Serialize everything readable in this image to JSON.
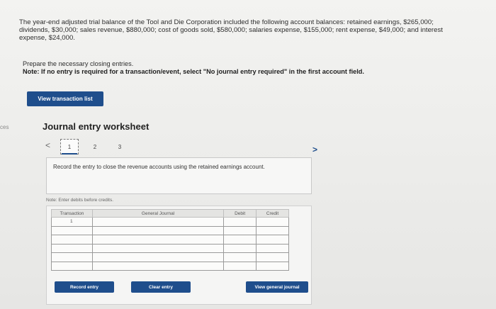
{
  "edge_label": "ces",
  "intro_text": "The year-end adjusted trial balance of the Tool and Die Corporation included the following account balances: retained earnings, $265,000; dividends, $30,000; sales revenue, $880,000; cost of goods sold, $580,000; salaries expense, $155,000; rent expense, $49,000; and interest expense, $24,000.",
  "instructions": {
    "line1": "Prepare the necessary closing entries.",
    "note": "Note: If no entry is required for a transaction/event, select \"No journal entry required\" in the first account field."
  },
  "view_transaction_list_label": "View transaction list",
  "worksheet": {
    "title": "Journal entry worksheet",
    "prev_glyph": "<",
    "next_glyph": ">",
    "steps": [
      "1",
      "2",
      "3"
    ],
    "active_step": 1,
    "task_text": "Record the entry to close the revenue accounts using the retained earnings account.",
    "note_text": "Note: Enter debits before credits.",
    "table": {
      "headers": [
        "Transaction",
        "General Journal",
        "Debit",
        "Credit"
      ],
      "rows": [
        {
          "transaction": "1",
          "account": "",
          "debit": "",
          "credit": ""
        },
        {
          "transaction": "",
          "account": "",
          "debit": "",
          "credit": ""
        },
        {
          "transaction": "",
          "account": "",
          "debit": "",
          "credit": ""
        },
        {
          "transaction": "",
          "account": "",
          "debit": "",
          "credit": ""
        },
        {
          "transaction": "",
          "account": "",
          "debit": "",
          "credit": ""
        },
        {
          "transaction": "",
          "account": "",
          "debit": "",
          "credit": ""
        }
      ]
    },
    "buttons": {
      "record": "Record entry",
      "clear": "Clear entry",
      "view": "View general journal"
    }
  },
  "colors": {
    "button_blue": "#1f4e8c",
    "background": "#ececea"
  }
}
